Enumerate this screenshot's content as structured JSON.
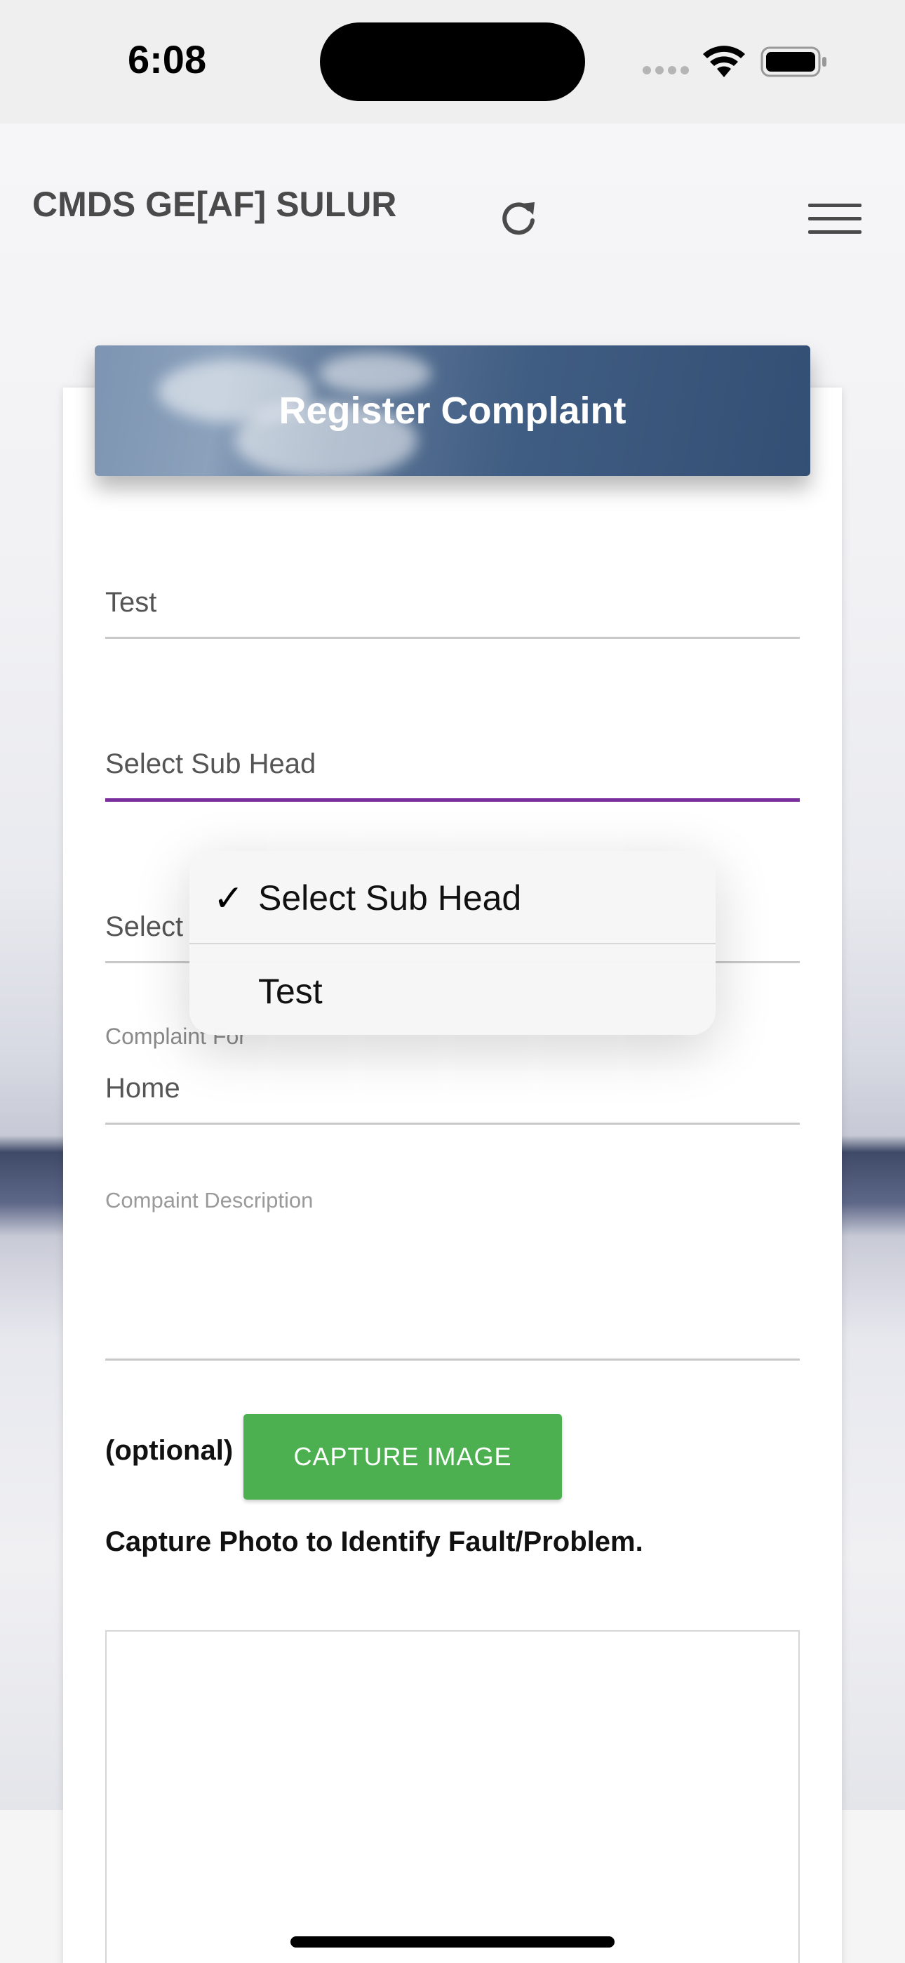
{
  "status_bar": {
    "time": "6:08"
  },
  "header": {
    "app_title": "CMDS GE[AF] SULUR",
    "refresh_icon": "refresh-icon",
    "menu_icon": "hamburger-menu-icon"
  },
  "form": {
    "title": "Register Complaint",
    "fields": [
      {
        "value": "Test"
      },
      {
        "value": "Select Sub Head"
      },
      {
        "value": "Select"
      },
      {
        "label": "Complaint For",
        "value": "Home"
      },
      {
        "placeholder": "Compaint Description"
      }
    ],
    "optional_label": "(optional)",
    "capture_button": "CAPTURE IMAGE",
    "capture_hint": "Capture Photo to Identify Fault/Problem."
  },
  "dropdown": {
    "selected_index": 0,
    "options": [
      "Select Sub Head",
      "Test"
    ],
    "check_glyph": "✓"
  },
  "colors": {
    "active_underline": "#7b2f9d",
    "capture_button": "#4caf50",
    "header_blue": "#3f5c82"
  }
}
